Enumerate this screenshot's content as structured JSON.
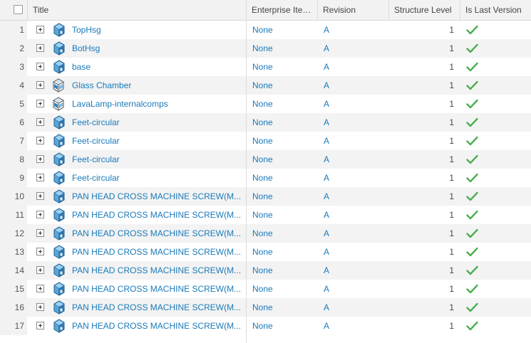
{
  "columns": {
    "title": "Title",
    "enterprise": "Enterprise Ite…",
    "revision": "Revision",
    "structure_level": "Structure Level",
    "is_last_version": "Is Last Version"
  },
  "rows": [
    {
      "num": "1",
      "title": "TopHsg",
      "enterprise": "None",
      "revision": "A",
      "level": "1",
      "icon": "part-icon",
      "last": true
    },
    {
      "num": "2",
      "title": "BotHsg",
      "enterprise": "None",
      "revision": "A",
      "level": "1",
      "icon": "part-icon",
      "last": true
    },
    {
      "num": "3",
      "title": "base",
      "enterprise": "None",
      "revision": "A",
      "level": "1",
      "icon": "part-icon",
      "last": true
    },
    {
      "num": "4",
      "title": "Glass Chamber",
      "enterprise": "None",
      "revision": "A",
      "level": "1",
      "icon": "assembly-icon",
      "last": true
    },
    {
      "num": "5",
      "title": "LavaLamp-internalcomps",
      "enterprise": "None",
      "revision": "A",
      "level": "1",
      "icon": "assembly-icon",
      "last": true
    },
    {
      "num": "6",
      "title": "Feet-circular",
      "enterprise": "None",
      "revision": "A",
      "level": "1",
      "icon": "part-icon",
      "last": true
    },
    {
      "num": "7",
      "title": "Feet-circular",
      "enterprise": "None",
      "revision": "A",
      "level": "1",
      "icon": "part-icon",
      "last": true
    },
    {
      "num": "8",
      "title": "Feet-circular",
      "enterprise": "None",
      "revision": "A",
      "level": "1",
      "icon": "part-icon",
      "last": true
    },
    {
      "num": "9",
      "title": "Feet-circular",
      "enterprise": "None",
      "revision": "A",
      "level": "1",
      "icon": "part-icon",
      "last": true
    },
    {
      "num": "10",
      "title": "PAN HEAD CROSS MACHINE SCREW(M...",
      "enterprise": "None",
      "revision": "A",
      "level": "1",
      "icon": "part-icon",
      "last": true
    },
    {
      "num": "11",
      "title": "PAN HEAD CROSS MACHINE SCREW(M...",
      "enterprise": "None",
      "revision": "A",
      "level": "1",
      "icon": "part-icon",
      "last": true
    },
    {
      "num": "12",
      "title": "PAN HEAD CROSS MACHINE SCREW(M...",
      "enterprise": "None",
      "revision": "A",
      "level": "1",
      "icon": "part-icon",
      "last": true
    },
    {
      "num": "13",
      "title": "PAN HEAD CROSS MACHINE SCREW(M...",
      "enterprise": "None",
      "revision": "A",
      "level": "1",
      "icon": "part-icon",
      "last": true
    },
    {
      "num": "14",
      "title": "PAN HEAD CROSS MACHINE SCREW(M...",
      "enterprise": "None",
      "revision": "A",
      "level": "1",
      "icon": "part-icon",
      "last": true
    },
    {
      "num": "15",
      "title": "PAN HEAD CROSS MACHINE SCREW(M...",
      "enterprise": "None",
      "revision": "A",
      "level": "1",
      "icon": "part-icon",
      "last": true
    },
    {
      "num": "16",
      "title": "PAN HEAD CROSS MACHINE SCREW(M...",
      "enterprise": "None",
      "revision": "A",
      "level": "1",
      "icon": "part-icon",
      "last": true
    },
    {
      "num": "17",
      "title": "PAN HEAD CROSS MACHINE SCREW(M...",
      "enterprise": "None",
      "revision": "A",
      "level": "1",
      "icon": "part-icon",
      "last": true
    }
  ],
  "colors": {
    "link": "#1a7ab9",
    "check": "#4caf50",
    "icon_blue": "#2d86c4"
  }
}
